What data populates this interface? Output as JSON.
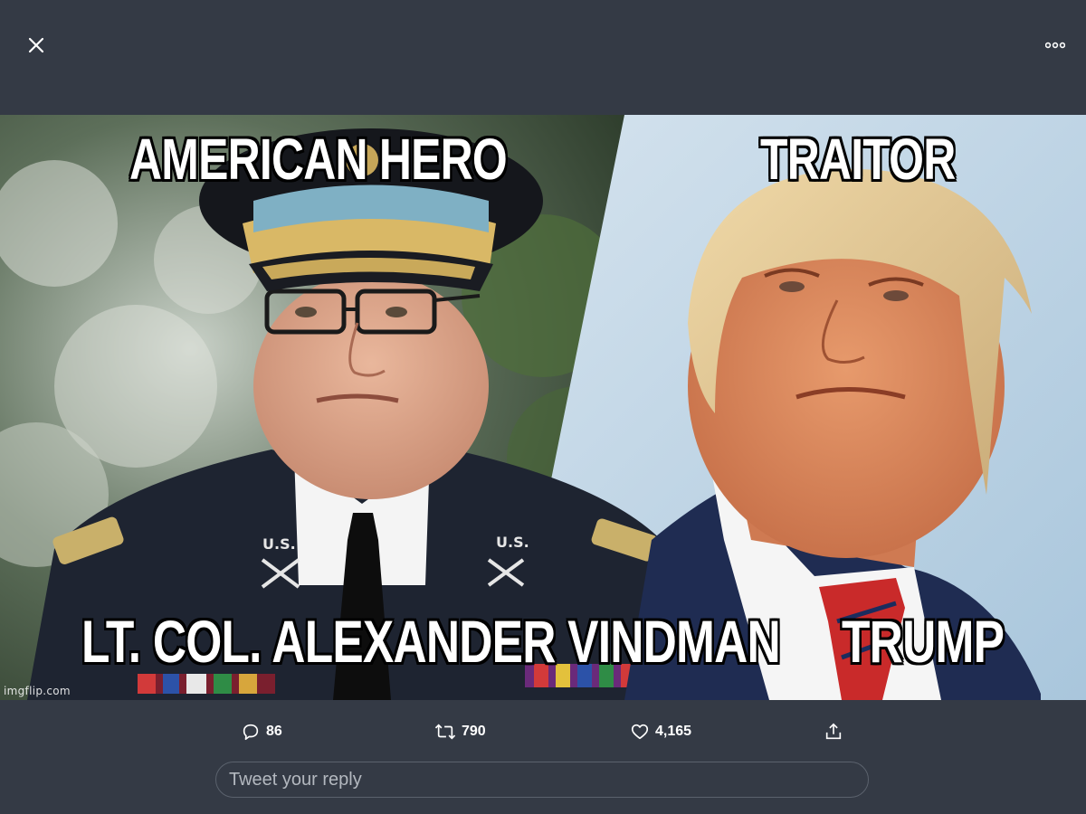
{
  "toolbar": {
    "close_icon": "close-icon",
    "more_icon": "more-horizontal-icon"
  },
  "media": {
    "captions": {
      "top_left": "AMERICAN HERO",
      "top_right": "TRAITOR",
      "bottom_left": "LT. COL. ALEXANDER VINDMAN",
      "bottom_right": "TRUMP"
    },
    "watermark": "imgflip.com"
  },
  "actions": {
    "replies": {
      "icon": "reply-icon",
      "count": "86"
    },
    "retweets": {
      "icon": "retweet-icon",
      "count": "790"
    },
    "likes": {
      "icon": "heart-icon",
      "count": "4,165"
    },
    "share": {
      "icon": "share-icon"
    }
  },
  "reply_box": {
    "placeholder": "Tweet your reply"
  },
  "colors": {
    "background": "#343a45",
    "text": "#ffffff",
    "placeholder": "#b3b8bf"
  }
}
